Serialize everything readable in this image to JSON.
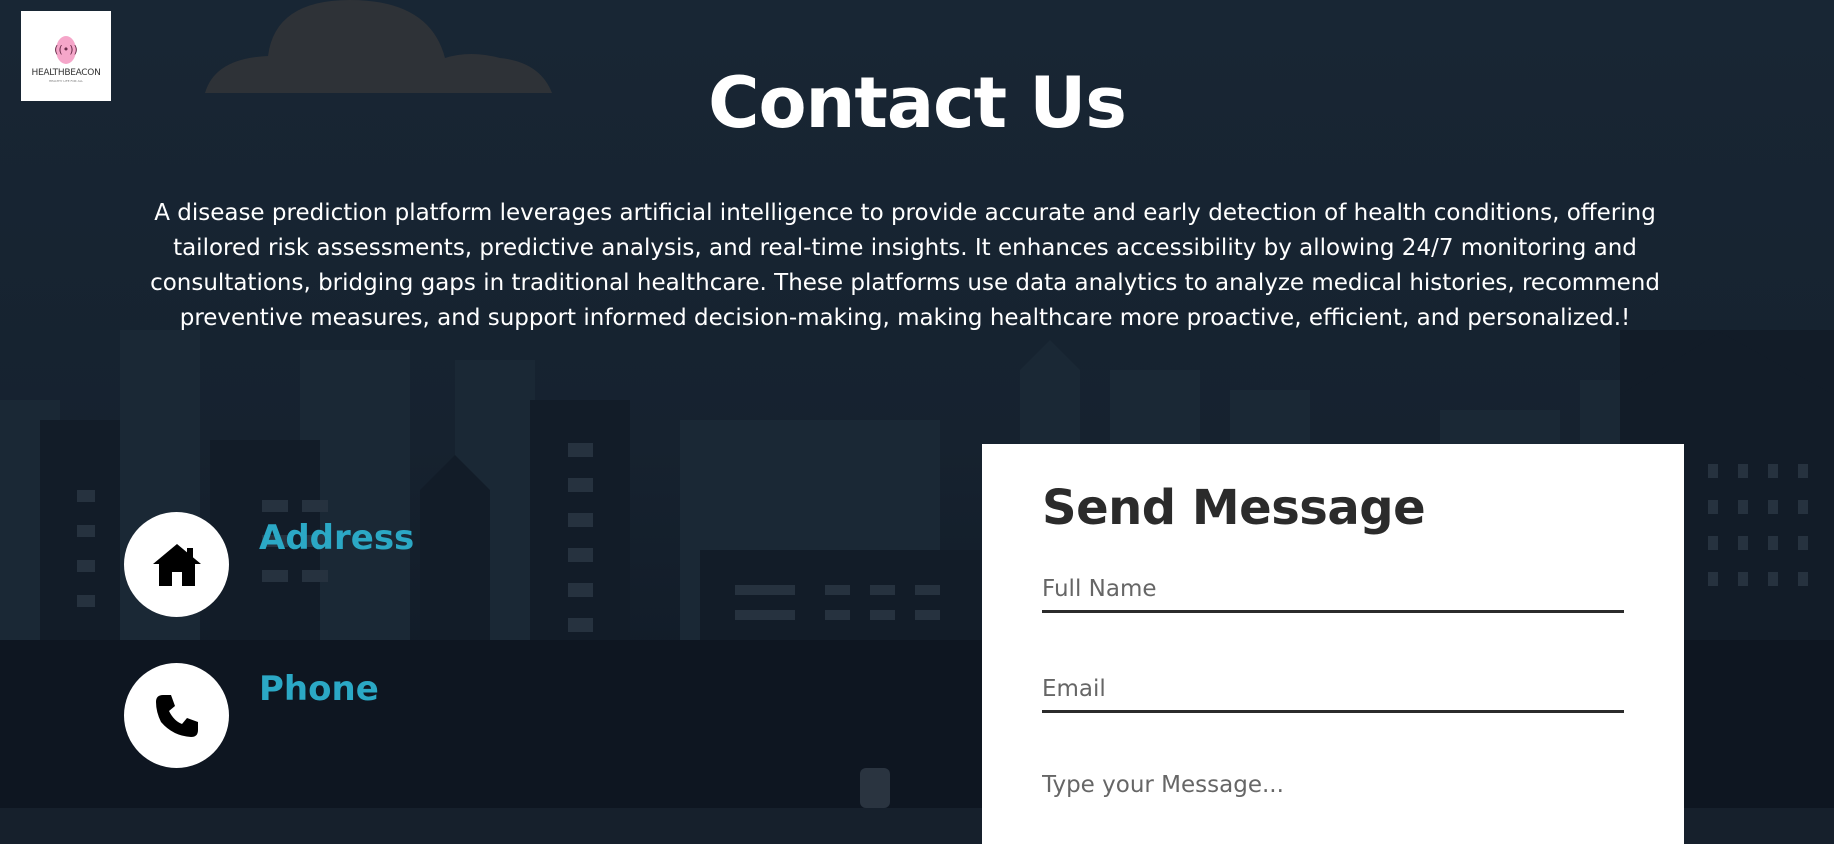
{
  "brand": {
    "logo_text": "HEALTHBEACON",
    "logo_subtext": "HEALTHY LIFE FOR ALL"
  },
  "hero": {
    "title": "Contact Us",
    "description": "A disease prediction platform leverages artificial intelligence to provide accurate and early detection of health conditions, offering tailored risk assessments, predictive analysis, and real-time insights. It enhances accessibility by allowing 24/7 monitoring and consultations, bridging gaps in traditional healthcare. These platforms use data analytics to analyze medical histories, recommend preventive measures, and support informed decision-making, making healthcare more proactive, efficient, and personalized.!"
  },
  "contact_info": [
    {
      "label": "Address",
      "icon": "home-icon"
    },
    {
      "label": "Phone",
      "icon": "phone-icon"
    }
  ],
  "form": {
    "title": "Send Message",
    "full_name_placeholder": "Full Name",
    "email_placeholder": "Email",
    "message_placeholder": "Type your Message..."
  },
  "colors": {
    "background": "#16202c",
    "accent": "#2ba8c5",
    "card": "#ffffff",
    "text_dark": "#2b2b2b"
  }
}
